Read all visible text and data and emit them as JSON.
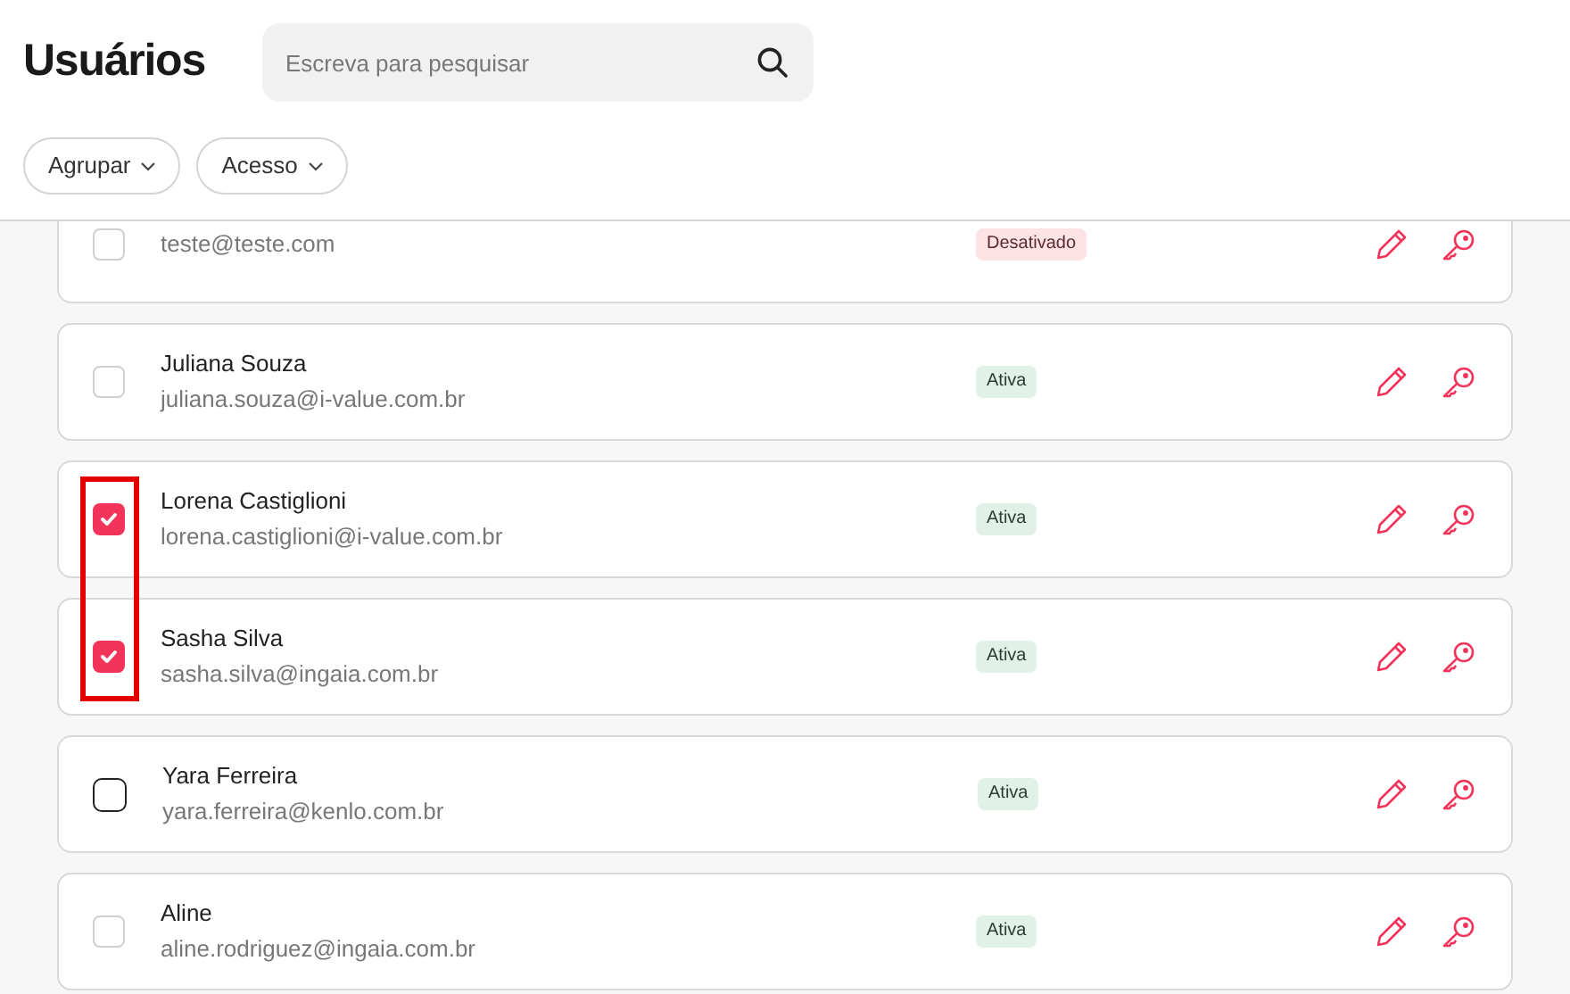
{
  "title": "Usuários",
  "search": {
    "placeholder": "Escreva para pesquisar"
  },
  "filters": [
    {
      "label": "Agrupar"
    },
    {
      "label": "Acesso"
    }
  ],
  "users": [
    {
      "email": "teste@teste.com",
      "status": {
        "text": "Desativado",
        "kind": "inactive"
      },
      "checked": false,
      "hovered": false
    },
    {
      "name": "Juliana Souza",
      "email": "juliana.souza@i-value.com.br",
      "status": {
        "text": "Ativa",
        "kind": "active"
      },
      "checked": false,
      "hovered": false
    },
    {
      "name": "Lorena Castiglioni",
      "email": "lorena.castiglioni@i-value.com.br",
      "status": {
        "text": "Ativa",
        "kind": "active"
      },
      "checked": true,
      "hovered": false
    },
    {
      "name": "Sasha Silva",
      "email": "sasha.silva@ingaia.com.br",
      "status": {
        "text": "Ativa",
        "kind": "active"
      },
      "checked": true,
      "hovered": false
    },
    {
      "name": "Yara Ferreira",
      "email": "yara.ferreira@kenlo.com.br",
      "status": {
        "text": "Ativa",
        "kind": "active"
      },
      "checked": false,
      "hovered": true
    },
    {
      "name": "Aline",
      "email": "aline.rodriguez@ingaia.com.br",
      "status": {
        "text": "Ativa",
        "kind": "active"
      },
      "checked": false,
      "hovered": false
    }
  ]
}
